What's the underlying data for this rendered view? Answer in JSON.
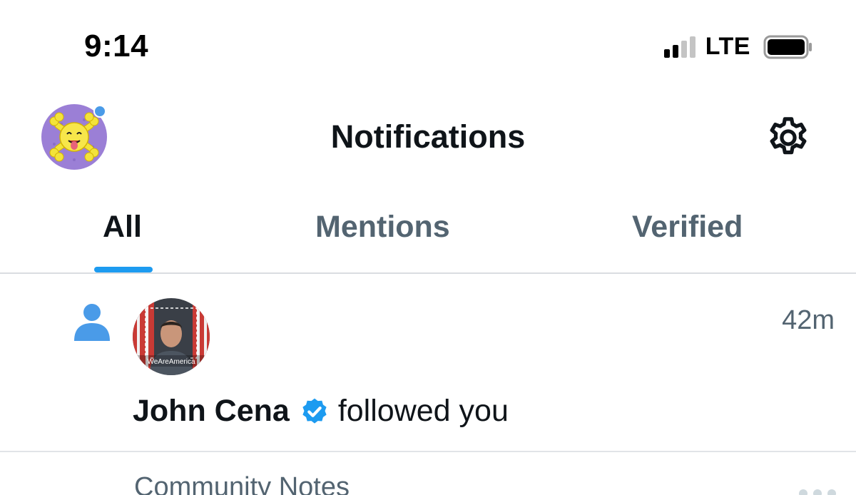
{
  "status_bar": {
    "time": "9:14",
    "network": "LTE",
    "signal_bars_active": 2,
    "signal_bars_total": 4
  },
  "header": {
    "title": "Notifications",
    "settings_icon": "gear-icon",
    "profile_icon": "emoji-avatar"
  },
  "tabs": [
    {
      "label": "All",
      "active": true
    },
    {
      "label": "Mentions",
      "active": false
    },
    {
      "label": "Verified",
      "active": false
    }
  ],
  "notifications": [
    {
      "type_icon": "person-icon",
      "avatar_caption": "WeAreAmerica",
      "time": "42m",
      "name": "John Cena",
      "verified": true,
      "action": "followed you"
    },
    {
      "label": "Community Notes"
    }
  ],
  "colors": {
    "accent": "#1d9bf0",
    "text_primary": "#0f1419",
    "text_secondary": "#536471",
    "divider": "#dadde1"
  }
}
